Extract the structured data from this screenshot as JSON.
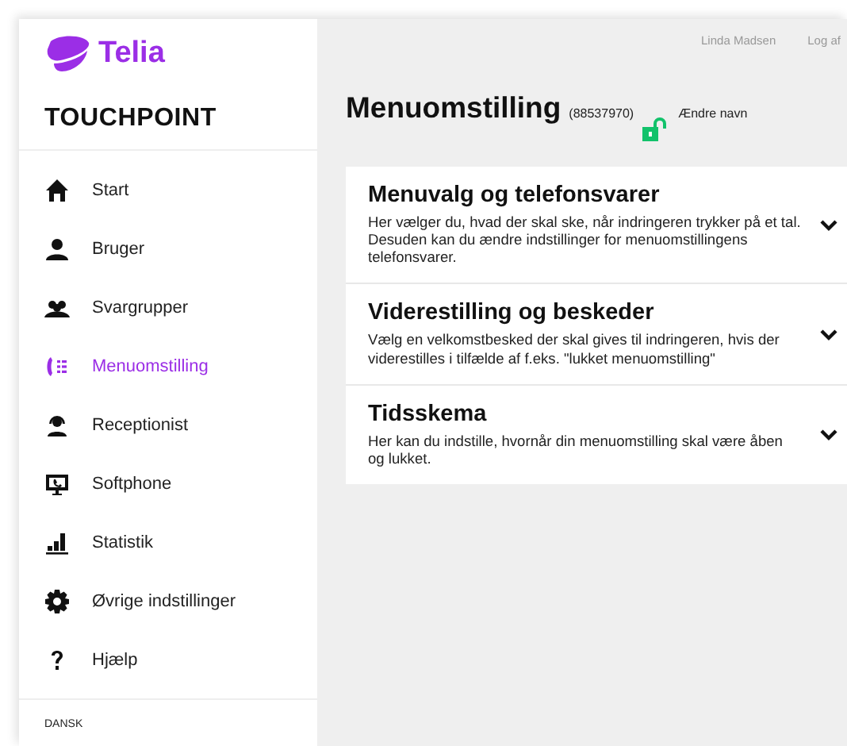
{
  "sidebar": {
    "logo": "Telia",
    "product": "TOUCHPOINT",
    "items": [
      {
        "kind": "home",
        "label": "Start",
        "selected": false
      },
      {
        "kind": "user",
        "label": "Bruger",
        "selected": false
      },
      {
        "kind": "group",
        "label": "Svargrupper",
        "selected": false
      },
      {
        "kind": "menu",
        "label": "Menuomstilling",
        "selected": true
      },
      {
        "kind": "headset",
        "label": "Receptionist",
        "selected": false
      },
      {
        "kind": "screen",
        "label": "Softphone",
        "selected": false
      },
      {
        "kind": "chart",
        "label": "Statistik",
        "selected": false
      },
      {
        "kind": "gear",
        "label": "Øvrige indstillinger",
        "selected": false
      },
      {
        "kind": "help",
        "label": "Hjælp",
        "selected": false
      }
    ],
    "language": "DANSK"
  },
  "topbar": {
    "user": "Linda Madsen",
    "logout": "Log af"
  },
  "page": {
    "title": "Menuomstilling",
    "number": "(88537970)",
    "rename": "Ændre navn"
  },
  "sections": [
    {
      "title": "Menuvalg og telefonsvarer",
      "description": "Her vælger du, hvad der skal ske, når indringeren trykker på et tal. Desuden kan du ændre indstillinger for menuomstillingens telefonsvarer."
    },
    {
      "title": "Viderestilling og beskeder",
      "description": "Vælg en velkomstbesked der skal gives til indringeren, hvis der viderestilles i tilfælde af f.eks. \"lukket menuomstilling\""
    },
    {
      "title": "Tidsskema",
      "description": "Her kan du indstille, hvornår din menuomstilling skal være åben og lukket."
    }
  ]
}
